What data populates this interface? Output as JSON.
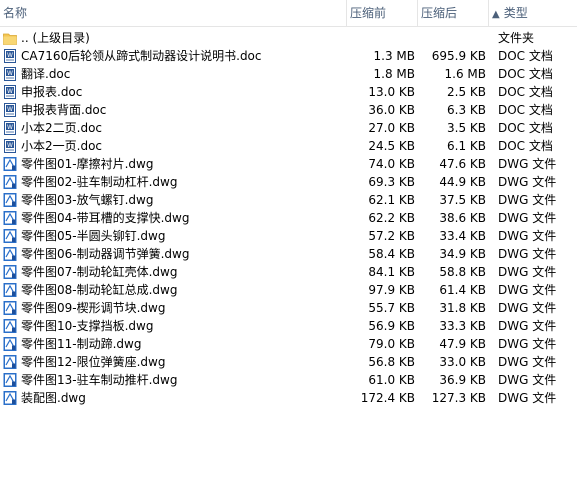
{
  "columns": {
    "name": "名称",
    "original_size": "压缩前",
    "compressed_size": "压缩后",
    "type_sort_arrow": "▲",
    "type": "类型"
  },
  "files": [
    {
      "name": ".. (上级目录)",
      "original": "",
      "compressed": "",
      "type": "文件夹",
      "icon": "folder-icon"
    },
    {
      "name": "CA7160后轮领从蹄式制动器设计说明书.doc",
      "original": "1.3 MB",
      "compressed": "695.9 KB",
      "type": "DOC 文档",
      "icon": "doc-file-icon"
    },
    {
      "name": "翻译.doc",
      "original": "1.8 MB",
      "compressed": "1.6 MB",
      "type": "DOC 文档",
      "icon": "doc-file-icon"
    },
    {
      "name": "申报表.doc",
      "original": "13.0 KB",
      "compressed": "2.5 KB",
      "type": "DOC 文档",
      "icon": "doc-file-icon"
    },
    {
      "name": "申报表背面.doc",
      "original": "36.0 KB",
      "compressed": "6.3 KB",
      "type": "DOC 文档",
      "icon": "doc-file-icon"
    },
    {
      "name": "小本2二页.doc",
      "original": "27.0 KB",
      "compressed": "3.5 KB",
      "type": "DOC 文档",
      "icon": "doc-file-icon"
    },
    {
      "name": "小本2一页.doc",
      "original": "24.5 KB",
      "compressed": "6.1 KB",
      "type": "DOC 文档",
      "icon": "doc-file-icon"
    },
    {
      "name": "零件图01-摩擦衬片.dwg",
      "original": "74.0 KB",
      "compressed": "47.6 KB",
      "type": "DWG 文件",
      "icon": "dwg-file-icon"
    },
    {
      "name": "零件图02-驻车制动杠杆.dwg",
      "original": "69.3 KB",
      "compressed": "44.9 KB",
      "type": "DWG 文件",
      "icon": "dwg-file-icon"
    },
    {
      "name": "零件图03-放气螺钉.dwg",
      "original": "62.1 KB",
      "compressed": "37.5 KB",
      "type": "DWG 文件",
      "icon": "dwg-file-icon"
    },
    {
      "name": "零件图04-带耳槽的支撑快.dwg",
      "original": "62.2 KB",
      "compressed": "38.6 KB",
      "type": "DWG 文件",
      "icon": "dwg-file-icon"
    },
    {
      "name": "零件图05-半圆头铆钉.dwg",
      "original": "57.2 KB",
      "compressed": "33.4 KB",
      "type": "DWG 文件",
      "icon": "dwg-file-icon"
    },
    {
      "name": "零件图06-制动器调节弹簧.dwg",
      "original": "58.4 KB",
      "compressed": "34.9 KB",
      "type": "DWG 文件",
      "icon": "dwg-file-icon"
    },
    {
      "name": "零件图07-制动轮缸壳体.dwg",
      "original": "84.1 KB",
      "compressed": "58.8 KB",
      "type": "DWG 文件",
      "icon": "dwg-file-icon"
    },
    {
      "name": "零件图08-制动轮缸总成.dwg",
      "original": "97.9 KB",
      "compressed": "61.4 KB",
      "type": "DWG 文件",
      "icon": "dwg-file-icon"
    },
    {
      "name": "零件图09-楔形调节块.dwg",
      "original": "55.7 KB",
      "compressed": "31.8 KB",
      "type": "DWG 文件",
      "icon": "dwg-file-icon"
    },
    {
      "name": "零件图10-支撑挡板.dwg",
      "original": "56.9 KB",
      "compressed": "33.3 KB",
      "type": "DWG 文件",
      "icon": "dwg-file-icon"
    },
    {
      "name": "零件图11-制动蹄.dwg",
      "original": "79.0 KB",
      "compressed": "47.9 KB",
      "type": "DWG 文件",
      "icon": "dwg-file-icon"
    },
    {
      "name": "零件图12-限位弹簧座.dwg",
      "original": "56.8 KB",
      "compressed": "33.0 KB",
      "type": "DWG 文件",
      "icon": "dwg-file-icon"
    },
    {
      "name": "零件图13-驻车制动推杆.dwg",
      "original": "61.0 KB",
      "compressed": "36.9 KB",
      "type": "DWG 文件",
      "icon": "dwg-file-icon"
    },
    {
      "name": "装配图.dwg",
      "original": "172.4 KB",
      "compressed": "127.3 KB",
      "type": "DWG 文件",
      "icon": "dwg-file-icon"
    }
  ],
  "colors": {
    "header_text": "#4c607a",
    "doc_icon": "#2b5797",
    "dwg_icon": "#2a6fc9",
    "folder_icon": "#f3c553"
  }
}
